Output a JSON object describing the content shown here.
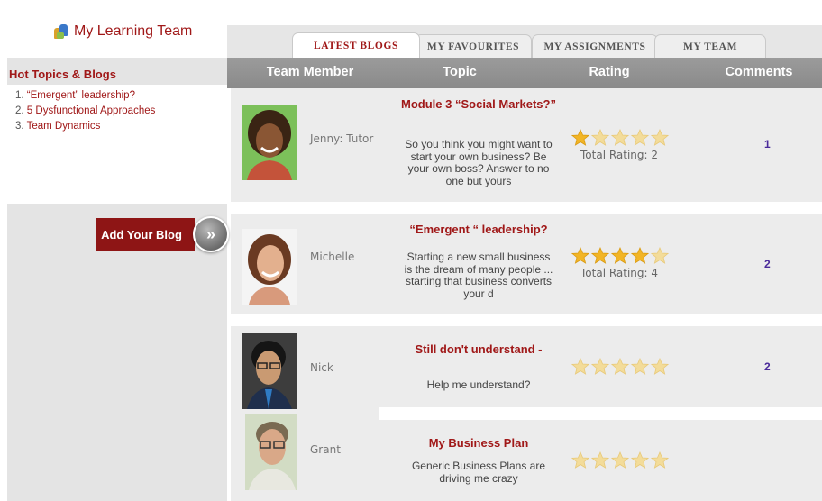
{
  "app": {
    "title": "My Learning Team",
    "logo_icon": "people-group-icon"
  },
  "sidebar": {
    "heading": "Hot Topics & Blogs",
    "items": [
      {
        "num": "1.",
        "label": "“Emergent” leadership?"
      },
      {
        "num": "2.",
        "label": "5 Dysfunctional Approaches"
      },
      {
        "num": "3.",
        "label": "Team Dynamics"
      }
    ],
    "add_blog_label": "Add Your Blog",
    "add_blog_arrow": "»"
  },
  "tabs": [
    {
      "label": "LATEST BLOGS",
      "active": true
    },
    {
      "label": "MY FAVOURITES",
      "active": false
    },
    {
      "label": "MY ASSIGNMENTS",
      "active": false
    },
    {
      "label": "MY TEAM",
      "active": false
    }
  ],
  "table": {
    "columns": [
      "Team Member",
      "Topic",
      "Rating",
      "Comments"
    ],
    "rows": [
      {
        "member": "Jenny: Tutor",
        "topic_title": "Module 3 “Social Markets?”",
        "topic_text": "So you think you might want to start your own business? Be your own boss? Answer to no one but yours",
        "rating": 1,
        "rating_max": 5,
        "total": "Total Rating: 2",
        "comments": "1"
      },
      {
        "member": "Michelle",
        "topic_title": "“Emergent “ leadership?",
        "topic_text": "Starting a new small business is the dream of many people ... starting that business converts your d",
        "rating": 4,
        "rating_max": 5,
        "total": "Total Rating: 4",
        "comments": "2"
      },
      {
        "member": "Nick",
        "topic_title": "Still don't understand -",
        "topic_text": "Help me understand?",
        "rating": 0,
        "rating_max": 5,
        "total": "",
        "comments": "2"
      },
      {
        "member": "Grant",
        "topic_title": "My Business Plan",
        "topic_text": "Generic Business Plans are driving me crazy",
        "rating": 0,
        "rating_max": 5,
        "total": "",
        "comments": ""
      }
    ]
  },
  "colors": {
    "brand_red": "#a01818",
    "button_red": "#8e1515",
    "header_gray": "#8f8f8f",
    "star_gold": "#f2b526",
    "star_empty": "#f3dc9a",
    "comment_link": "#4a2a9a"
  }
}
